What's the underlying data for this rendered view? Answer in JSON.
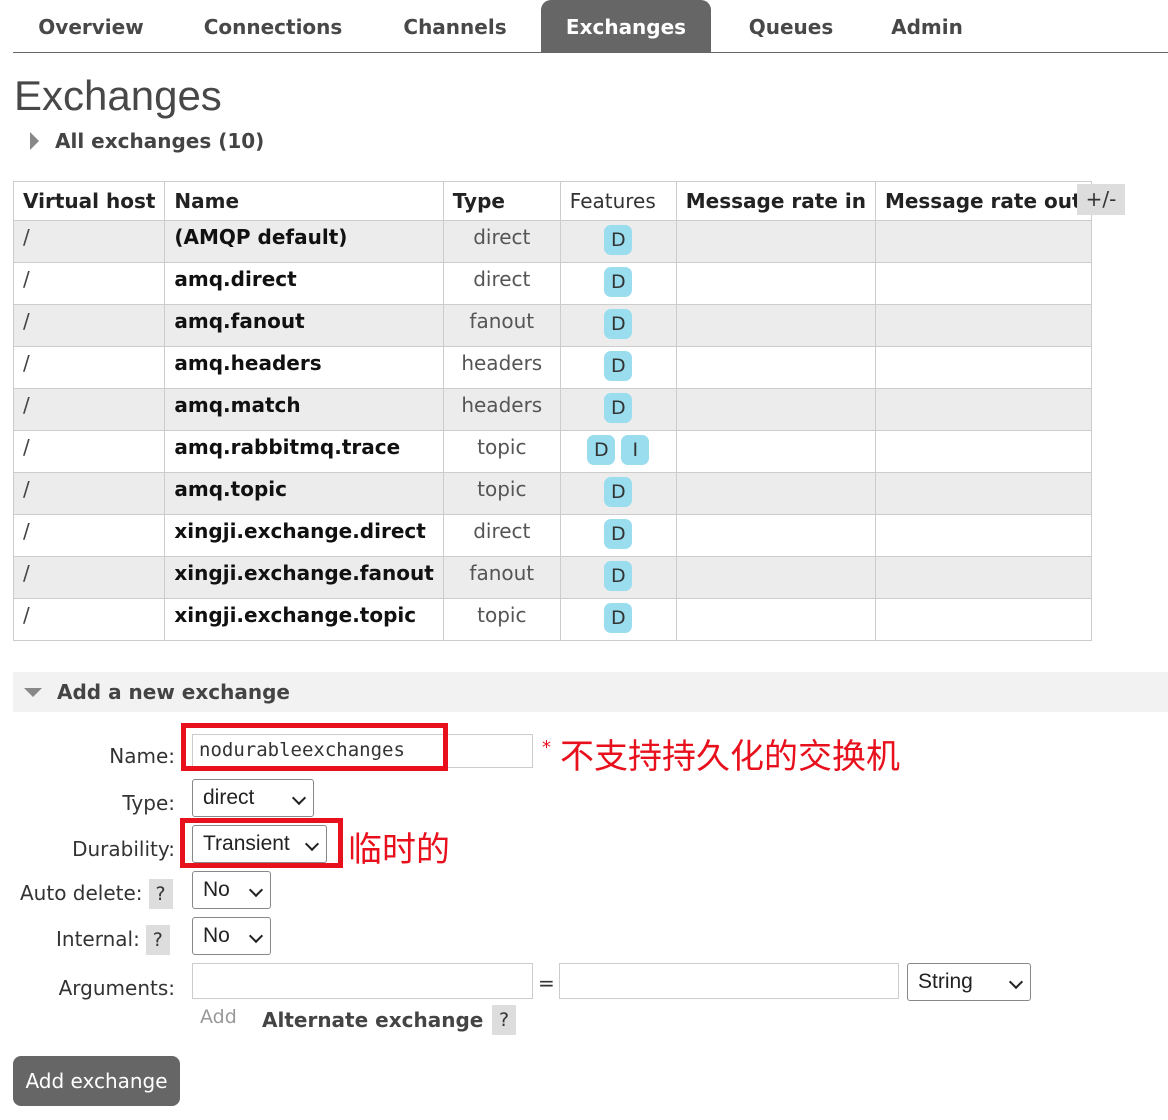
{
  "nav": {
    "tabs": [
      {
        "label": "Overview"
      },
      {
        "label": "Connections"
      },
      {
        "label": "Channels"
      },
      {
        "label": "Exchanges",
        "active": true
      },
      {
        "label": "Queues"
      },
      {
        "label": "Admin"
      }
    ]
  },
  "page": {
    "title": "Exchanges",
    "all_toggle": "All exchanges (10)"
  },
  "table": {
    "headers": [
      "Virtual host",
      "Name",
      "Type",
      "Features",
      "Message rate in",
      "Message rate out"
    ],
    "toggle_columns": "+/-",
    "rows": [
      {
        "vhost": "/",
        "name": "(AMQP default)",
        "type": "direct",
        "features": [
          "D"
        ]
      },
      {
        "vhost": "/",
        "name": "amq.direct",
        "type": "direct",
        "features": [
          "D"
        ]
      },
      {
        "vhost": "/",
        "name": "amq.fanout",
        "type": "fanout",
        "features": [
          "D"
        ]
      },
      {
        "vhost": "/",
        "name": "amq.headers",
        "type": "headers",
        "features": [
          "D"
        ]
      },
      {
        "vhost": "/",
        "name": "amq.match",
        "type": "headers",
        "features": [
          "D"
        ]
      },
      {
        "vhost": "/",
        "name": "amq.rabbitmq.trace",
        "type": "topic",
        "features": [
          "D",
          "I"
        ]
      },
      {
        "vhost": "/",
        "name": "amq.topic",
        "type": "topic",
        "features": [
          "D"
        ]
      },
      {
        "vhost": "/",
        "name": "xingji.exchange.direct",
        "type": "direct",
        "features": [
          "D"
        ]
      },
      {
        "vhost": "/",
        "name": "xingji.exchange.fanout",
        "type": "fanout",
        "features": [
          "D"
        ]
      },
      {
        "vhost": "/",
        "name": "xingji.exchange.topic",
        "type": "topic",
        "features": [
          "D"
        ]
      }
    ]
  },
  "add_form": {
    "header": "Add a new exchange",
    "name_label": "Name:",
    "name_value": "nodurableexchanges",
    "required_mark": "*",
    "type_label": "Type:",
    "type_value": "direct",
    "durability_label": "Durability:",
    "durability_value": "Transient",
    "auto_delete_label": "Auto delete:",
    "auto_delete_value": "No",
    "internal_label": "Internal:",
    "internal_value": "No",
    "help": "?",
    "arguments_label": "Arguments:",
    "equals": "=",
    "arg_type_value": "String",
    "add_link": "Add",
    "alternate_exchange": "Alternate exchange",
    "submit": "Add exchange"
  },
  "annotations": {
    "name_note": "不支持持久化的交换机",
    "durability_note": "临时的",
    "color": "#e8101c"
  }
}
